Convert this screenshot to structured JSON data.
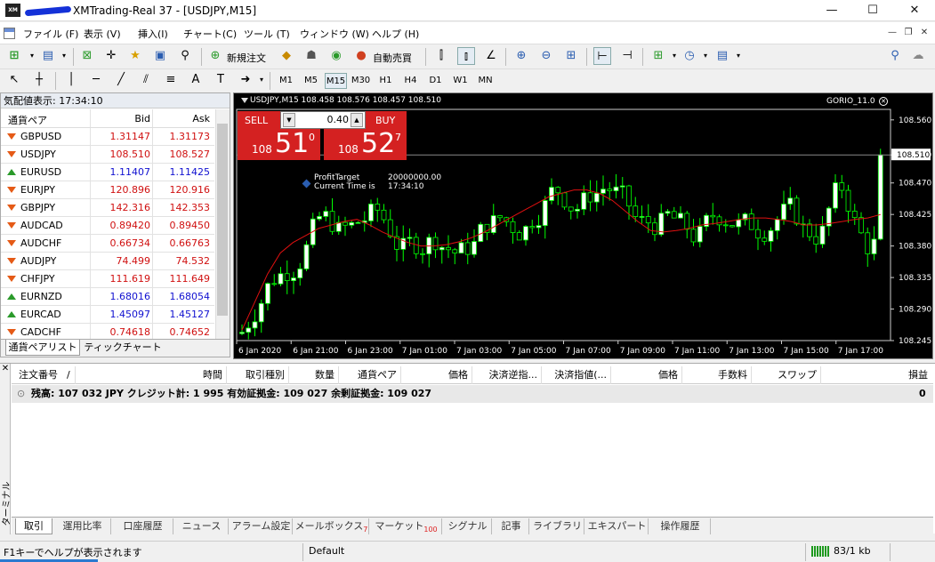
{
  "window": {
    "title": "XMTrading-Real 37 - [USDJPY,M15]",
    "logo_text": "XM",
    "minimize": "—",
    "maximize": "☐",
    "close": "✕"
  },
  "menu": [
    "ファイル (F)",
    "表示 (V)",
    "挿入(I)",
    "チャート(C)",
    "ツール (T)",
    "ウィンドウ (W)",
    "ヘルプ (H)"
  ],
  "toolbar": {
    "new_order": "新規注文",
    "auto_trading": "自動売買",
    "timeframes": [
      "M1",
      "M5",
      "M15",
      "M30",
      "H1",
      "H4",
      "D1",
      "W1",
      "MN"
    ],
    "active_timeframe": "M15"
  },
  "market_watch": {
    "header": "気配値表示: 17:34:10",
    "col_symbol": "通貨ペア",
    "col_bid": "Bid",
    "col_ask": "Ask",
    "rows": [
      {
        "symbol": "GBPUSD",
        "bid": "1.31147",
        "ask": "1.31173",
        "dir": "down"
      },
      {
        "symbol": "USDJPY",
        "bid": "108.510",
        "ask": "108.527",
        "dir": "down"
      },
      {
        "symbol": "EURUSD",
        "bid": "1.11407",
        "ask": "1.11425",
        "dir": "up"
      },
      {
        "symbol": "EURJPY",
        "bid": "120.896",
        "ask": "120.916",
        "dir": "down"
      },
      {
        "symbol": "GBPJPY",
        "bid": "142.316",
        "ask": "142.353",
        "dir": "down"
      },
      {
        "symbol": "AUDCAD",
        "bid": "0.89420",
        "ask": "0.89450",
        "dir": "down"
      },
      {
        "symbol": "AUDCHF",
        "bid": "0.66734",
        "ask": "0.66763",
        "dir": "down"
      },
      {
        "symbol": "AUDJPY",
        "bid": "74.499",
        "ask": "74.532",
        "dir": "down"
      },
      {
        "symbol": "CHFJPY",
        "bid": "111.619",
        "ask": "111.649",
        "dir": "down"
      },
      {
        "symbol": "EURNZD",
        "bid": "1.68016",
        "ask": "1.68054",
        "dir": "up"
      },
      {
        "symbol": "EURCAD",
        "bid": "1.45097",
        "ask": "1.45127",
        "dir": "up"
      },
      {
        "symbol": "CADCHF",
        "bid": "0.74618",
        "ask": "0.74652",
        "dir": "down"
      }
    ],
    "tabs": [
      "通貨ペアリスト",
      "ティックチャート"
    ]
  },
  "chart": {
    "header": "USDJPY,M15  108.458 108.576 108.457 108.510",
    "indicator": "GORIO_11.0",
    "sell_label": "SELL",
    "buy_label": "BUY",
    "lot": "0.40",
    "sell_small": "108",
    "sell_big": "51",
    "sell_sup": "0",
    "buy_small": "108",
    "buy_big": "52",
    "buy_sup": "7",
    "annotation_left": [
      "ProfitTarget",
      "Current Time is"
    ],
    "annotation_right": [
      "20000000.00",
      "17:34:10"
    ],
    "current_price": "108.510",
    "colors": {
      "background": "#000000",
      "up_candle": "#ffffff",
      "down_candle": "#000000",
      "wick": "#00ff00",
      "ma": "#e01010",
      "price_line": "#888888"
    }
  },
  "chart_data": {
    "type": "candlestick",
    "symbol": "USDJPY",
    "timeframe": "M15",
    "y_ticks": [
      "108.560",
      "108.510",
      "108.470",
      "108.425",
      "108.380",
      "108.335",
      "108.290",
      "108.245"
    ],
    "ylim": [
      108.245,
      108.575
    ],
    "x_ticks": [
      "6 Jan 2020",
      "6 Jan 21:00",
      "6 Jan 23:00",
      "7 Jan 01:00",
      "7 Jan 03:00",
      "7 Jan 05:00",
      "7 Jan 07:00",
      "7 Jan 09:00",
      "7 Jan 11:00",
      "7 Jan 13:00",
      "7 Jan 15:00",
      "7 Jan 17:00"
    ],
    "current_price": 108.51,
    "ma": [
      108.26,
      108.3,
      108.34,
      108.37,
      108.385,
      108.395,
      108.405,
      108.41,
      108.415,
      108.418,
      108.41,
      108.4,
      108.392,
      108.385,
      108.38,
      108.38,
      108.382,
      108.386,
      108.392,
      108.4,
      108.41,
      108.42,
      108.43,
      108.44,
      108.45,
      108.455,
      108.46,
      108.46,
      108.455,
      108.445,
      108.43,
      108.415,
      108.402,
      108.4,
      108.402,
      108.405,
      108.41,
      108.412,
      108.415,
      108.418,
      108.42,
      108.42,
      108.418,
      108.415,
      108.41,
      108.41,
      108.412,
      108.415,
      108.418,
      108.42,
      108.425
    ]
  },
  "terminal": {
    "side_label": "ターミナル",
    "columns": [
      "注文番号",
      "/",
      "時間",
      "取引種別",
      "数量",
      "通貨ペア",
      "価格",
      "決済逆指...",
      "決済指値(...",
      "価格",
      "手数料",
      "スワップ",
      "損益"
    ],
    "balance_text": "残高: 107 032 JPY  クレジット計: 1 995  有効証拠金: 109 027  余剰証拠金: 109 027",
    "balance_value": "0",
    "tabs": [
      "取引",
      "運用比率",
      "口座履歴",
      "ニュース",
      "アラーム設定",
      "メールボックス",
      "マーケット",
      "シグナル",
      "記事",
      "ライブラリ",
      "エキスパート",
      "操作履歴"
    ],
    "mailbox_badge": "7",
    "market_badge": "100"
  },
  "status": {
    "help": "F1キーでヘルプが表示されます",
    "profile": "Default",
    "traffic": "83/1 kb"
  }
}
